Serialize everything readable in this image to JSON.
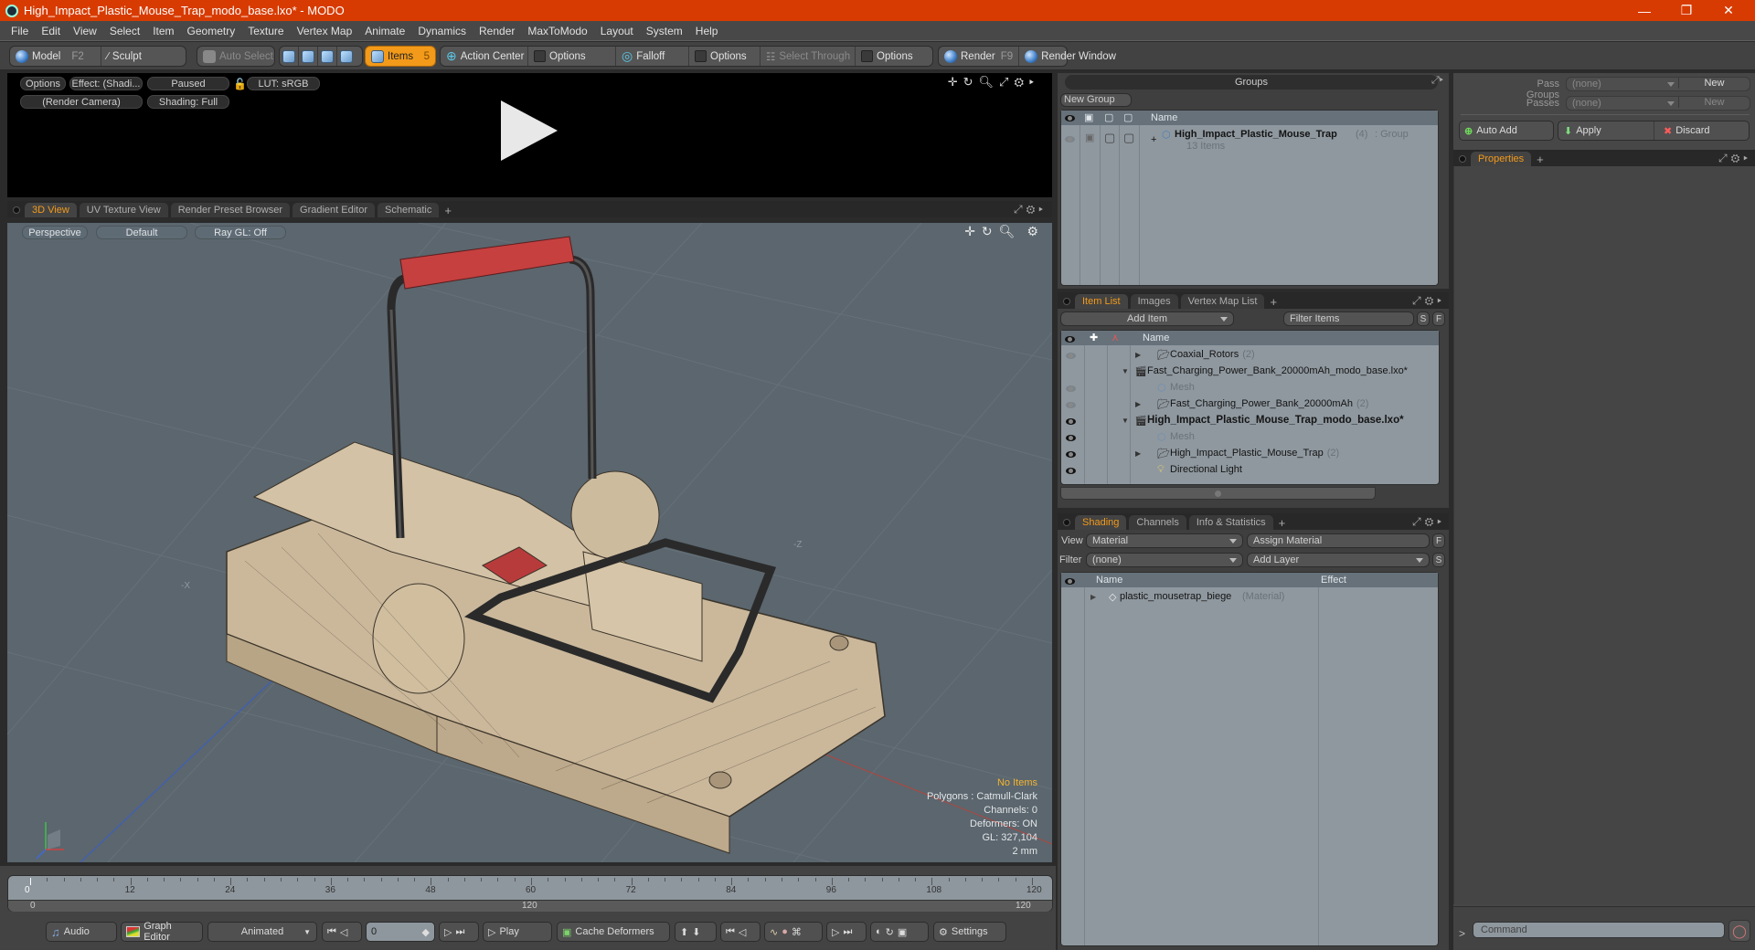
{
  "window": {
    "title": "High_Impact_Plastic_Mouse_Trap_modo_base.lxo* - MODO",
    "controls": [
      "minimize-icon",
      "restore-icon",
      "close-icon"
    ]
  },
  "menu": [
    "File",
    "Edit",
    "View",
    "Select",
    "Item",
    "Geometry",
    "Texture",
    "Vertex Map",
    "Animate",
    "Dynamics",
    "Render",
    "MaxToModo",
    "Layout",
    "System",
    "Help"
  ],
  "toolbar": {
    "model": "Model",
    "model_key": "F2",
    "sculpt": "Sculpt",
    "auto_select": "Auto Select",
    "items": "Items",
    "items_key": "5",
    "action_center": "Action Center",
    "options1": "Options",
    "falloff": "Falloff",
    "options2": "Options",
    "select_through": "Select Through",
    "options3": "Options",
    "render": "Render",
    "render_key": "F9",
    "render_window": "Render Window"
  },
  "render_preview": {
    "options": "Options",
    "effect": "Effect: (Shadi...",
    "paused": "Paused",
    "lut": "LUT: sRGB",
    "camera": "(Render Camera)",
    "shading": "Shading: Full"
  },
  "viewport_tabs": [
    "3D View",
    "UV Texture View",
    "Render Preset Browser",
    "Gradient Editor",
    "Schematic"
  ],
  "viewport": {
    "projection": "Perspective",
    "style": "Default",
    "raygl": "Ray GL: Off",
    "axis_labels": {
      "neg_x": "-X",
      "neg_z": "-Z"
    },
    "info": {
      "selection": "No Items",
      "polygons": "Polygons : Catmull-Clark",
      "channels": "Channels: 0",
      "deformers": "Deformers: ON",
      "gl": "GL: 327,104",
      "grid": "2 mm"
    },
    "accent": "#f3b32e"
  },
  "timeline": {
    "ticks": [
      "0",
      "12",
      "24",
      "36",
      "48",
      "60",
      "72",
      "84",
      "96",
      "108",
      "120"
    ],
    "range_start": "0",
    "range_mid": "120",
    "range_end": "120"
  },
  "transport": {
    "audio": "Audio",
    "graph_editor": "Graph Editor",
    "animated": "Animated",
    "frame": "0",
    "play": "Play",
    "cache_deformers": "Cache Deformers",
    "settings": "Settings"
  },
  "groups": {
    "title": "Groups",
    "new_group": "New Group",
    "column_name": "Name",
    "row": {
      "name": "High_Impact_Plastic_Mouse_Trap",
      "count": "(4)",
      "type": ": Group",
      "sub": "13 Items"
    }
  },
  "item_list": {
    "tabs": [
      "Item List",
      "Images",
      "Vertex Map List"
    ],
    "add_item": "Add Item",
    "filter_placeholder": "Filter Items",
    "s_btn": "S",
    "f_btn": "F",
    "column_name": "Name",
    "rows": [
      {
        "name": "Coaxial_Rotors",
        "count": "(2)",
        "type": "group",
        "visible": "dim"
      },
      {
        "name": "Fast_Charging_Power_Bank_20000mAh_modo_base.lxo*",
        "count": "",
        "type": "scene",
        "visible": "none"
      },
      {
        "name": "Mesh",
        "count": "",
        "type": "mesh",
        "visible": "dim"
      },
      {
        "name": "Fast_Charging_Power_Bank_20000mAh",
        "count": "(2)",
        "type": "group",
        "visible": "dim"
      },
      {
        "name": "High_Impact_Plastic_Mouse_Trap_modo_base.lxo*",
        "count": "",
        "type": "scene-bold",
        "visible": "on"
      },
      {
        "name": "Mesh",
        "count": "",
        "type": "mesh",
        "visible": "on"
      },
      {
        "name": "High_Impact_Plastic_Mouse_Trap",
        "count": "(2)",
        "type": "group",
        "visible": "on"
      },
      {
        "name": "Directional Light",
        "count": "",
        "type": "light",
        "visible": "on"
      }
    ]
  },
  "shading": {
    "tabs": [
      "Shading",
      "Channels",
      "Info & Statistics"
    ],
    "view_label": "View",
    "view_value": "Material",
    "assign_material": "Assign Material",
    "filter_label": "Filter",
    "filter_value": "(none)",
    "add_layer": "Add Layer",
    "f_btn": "F",
    "s_btn": "S",
    "col_name": "Name",
    "col_effect": "Effect",
    "rows": [
      {
        "name": "plastic_mousetrap_biege",
        "type": "(Material)"
      }
    ]
  },
  "pass": {
    "pass_groups_label": "Pass Groups",
    "pass_groups_value": "(none)",
    "new1": "New",
    "passes_label": "Passes",
    "passes_value": "(none)",
    "new2": "New",
    "auto_add": "Auto Add",
    "apply": "Apply",
    "discard": "Discard"
  },
  "properties": {
    "tab": "Properties"
  },
  "command": {
    "placeholder": "Command",
    "prompt": ">"
  }
}
